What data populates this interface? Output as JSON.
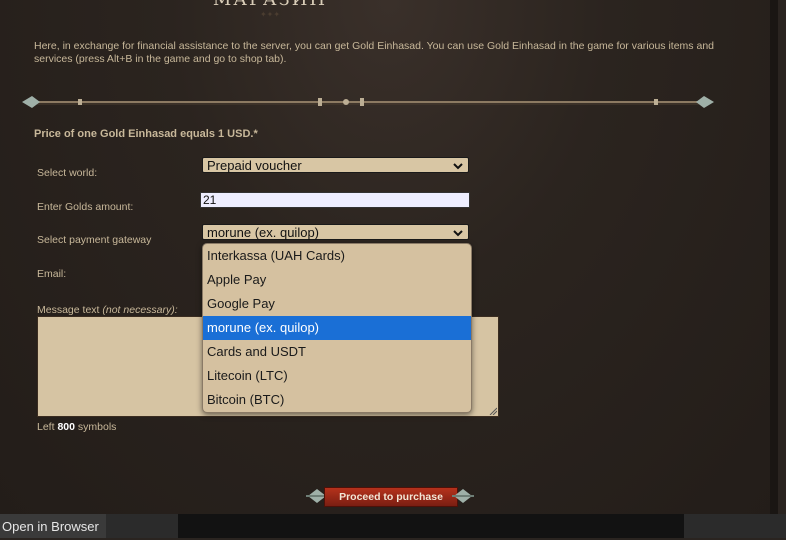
{
  "header": {
    "title": "МАГАЗИН"
  },
  "intro": "Here, in exchange for financial assistance to the server, you can get Gold Einhasad. You can use Gold Einhasad in the game for various items and services (press Alt+B in the game and go to shop tab).",
  "price_note": "Price of one Gold Einhasad equals 1 USD.*",
  "form": {
    "world_label": "Select world:",
    "world_value": "Prepaid voucher",
    "golds_label": "Enter Golds amount:",
    "golds_value": "21",
    "gateway_label": "Select payment gateway",
    "gateway_value": "morune (ex. quilop)",
    "email_label": "Email:",
    "message_label": "Message text",
    "message_optional": "(not necessary):",
    "left_prefix": "Left",
    "left_count": "800",
    "left_suffix": "symbols"
  },
  "dropdown": {
    "options": [
      "Interkassa (UAH Cards)",
      "Apple Pay",
      "Google Pay",
      "morune (ex. quilop)",
      "Cards and USDT",
      "Litecoin (LTC)",
      "Bitcoin (BTC)"
    ],
    "selected_index": 3
  },
  "proceed_label": "Proceed to purchase",
  "taskbar": {
    "open_browser": "Open in Browser"
  },
  "colors": {
    "text": "#c8b89a",
    "select_bg": "#d8c6a4",
    "highlight": "#1a6fd6",
    "button": "#b5321c"
  }
}
